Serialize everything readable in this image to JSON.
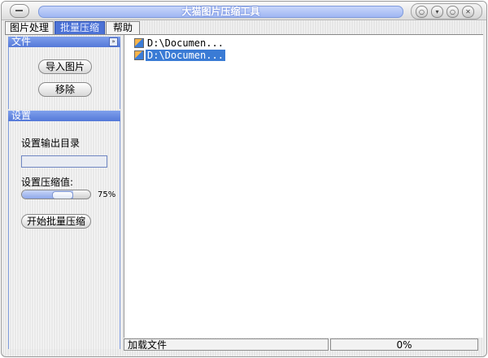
{
  "window": {
    "title": "大猫图片压缩工具",
    "controls": [
      {
        "name": "menu-icon",
        "glyph": "○"
      },
      {
        "name": "minimize-icon",
        "glyph": "▾"
      },
      {
        "name": "maximize-icon",
        "glyph": "○"
      },
      {
        "name": "close-icon",
        "glyph": "✕"
      }
    ]
  },
  "tabs": [
    {
      "label": "图片处理",
      "active": false
    },
    {
      "label": "批量压缩",
      "active": true
    },
    {
      "label": "帮助",
      "active": false
    }
  ],
  "file_panel": {
    "header": "文件",
    "toggle_glyph": "»",
    "import_button": "导入图片",
    "remove_button": "移除"
  },
  "settings_panel": {
    "header": "设置",
    "output_dir_label": "设置输出目录",
    "output_dir_value": "",
    "compression_label": "设置压缩值:",
    "compression_value": 75,
    "compression_text": "75%",
    "start_button": "开始批量压缩"
  },
  "file_list": [
    {
      "path": "D:\\Documen...",
      "selected": false
    },
    {
      "path": "D:\\Documen...",
      "selected": true
    }
  ],
  "status": {
    "message": "加载文件",
    "progress_text": "0%"
  },
  "colors": {
    "accent": "#4c72d6",
    "selection": "#3a7bd5"
  }
}
